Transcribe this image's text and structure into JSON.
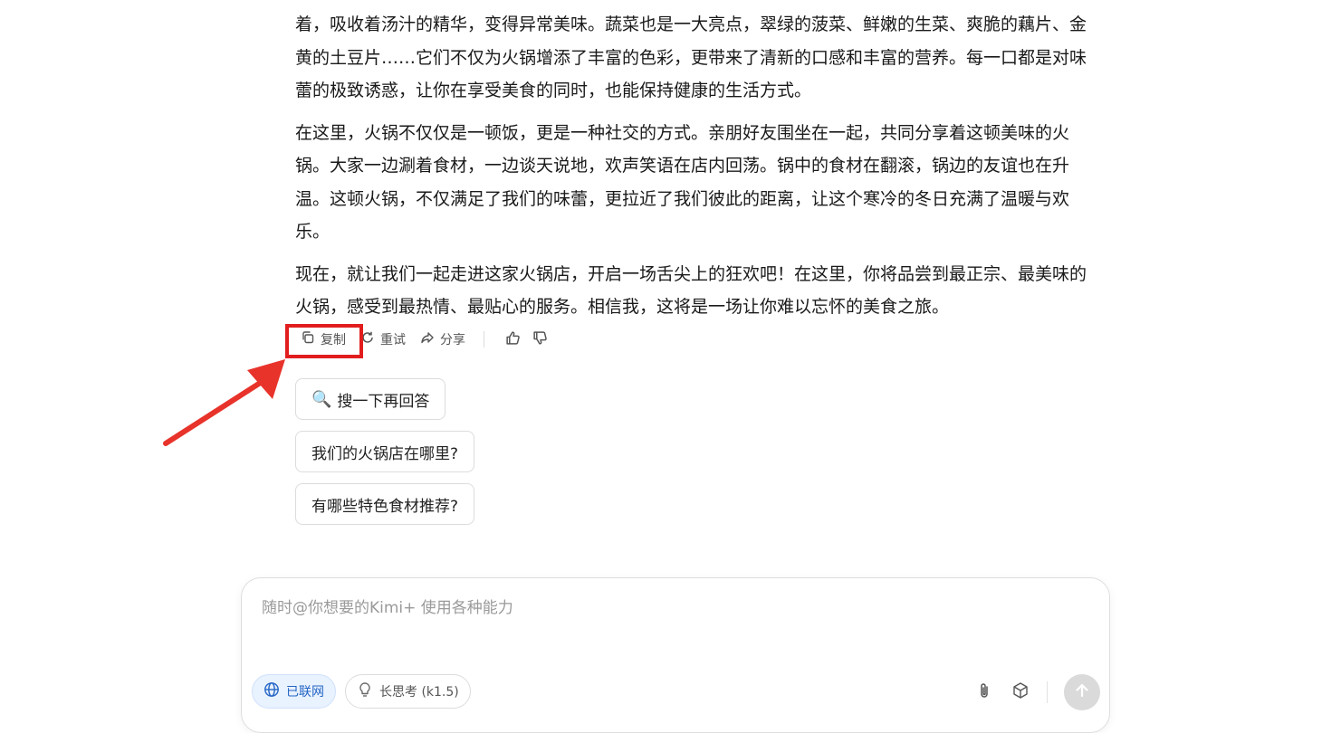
{
  "article": {
    "paragraphs": [
      "着，吸收着汤汁的精华，变得异常美味。蔬菜也是一大亮点，翠绿的菠菜、鲜嫩的生菜、爽脆的藕片、金黄的土豆片……它们不仅为火锅增添了丰富的色彩，更带来了清新的口感和丰富的营养。每一口都是对味蕾的极致诱惑，让你在享受美食的同时，也能保持健康的生活方式。",
      "在这里，火锅不仅仅是一顿饭，更是一种社交的方式。亲朋好友围坐在一起，共同分享着这顿美味的火锅。大家一边涮着食材，一边谈天说地，欢声笑语在店内回荡。锅中的食材在翻滚，锅边的友谊也在升温。这顿火锅，不仅满足了我们的味蕾，更拉近了我们彼此的距离，让这个寒冷的冬日充满了温暖与欢乐。",
      "现在，就让我们一起走进这家火锅店，开启一场舌尖上的狂欢吧！在这里，你将品尝到最正宗、最美味的火锅，感受到最热情、最贴心的服务。相信我，这将是一场让你难以忘怀的美食之旅。"
    ]
  },
  "actions": {
    "copy_label": "复制",
    "retry_label": "重试",
    "share_label": "分享"
  },
  "suggestions": {
    "search_icon": "🔍",
    "search_label": "搜一下再回答",
    "q1": "我们的火锅店在哪里?",
    "q2": "有哪些特色食材推荐?"
  },
  "composer": {
    "placeholder": "随时@你想要的Kimi+ 使用各种能力",
    "web_chip_label": "已联网",
    "think_chip_label": "长思考 (k1.5)"
  },
  "colors": {
    "annotation_red": "#e21d1d",
    "web_chip_blue": "#2466c4",
    "send_disabled": "#dadada"
  },
  "icons": [
    "copy-icon",
    "retry-icon",
    "share-icon",
    "thumbs-up-icon",
    "thumbs-down-icon",
    "search-icon",
    "globe-icon",
    "lightbulb-icon",
    "paperclip-icon",
    "cube-icon",
    "arrow-up-icon"
  ]
}
